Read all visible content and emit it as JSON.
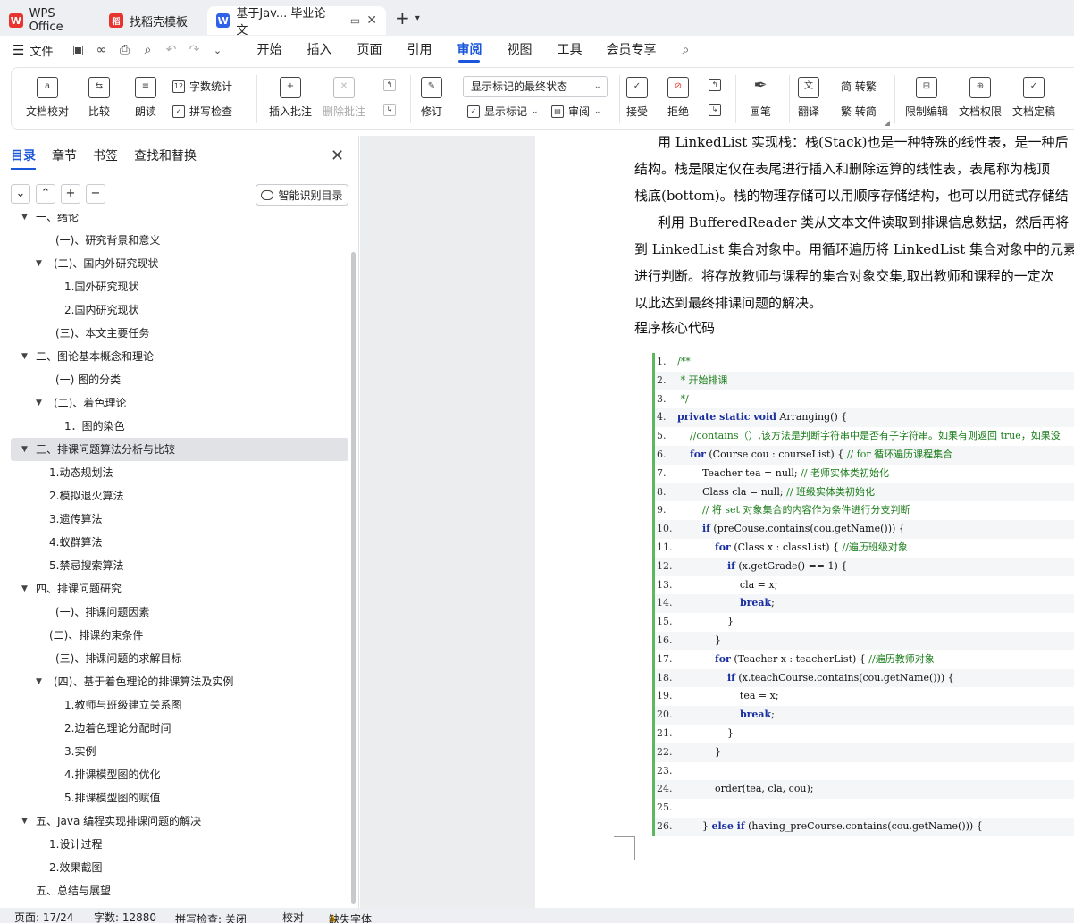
{
  "tabs": [
    {
      "label": "WPS Office",
      "logo": "W"
    },
    {
      "label": "找稻壳模板",
      "logo": "稻"
    },
    {
      "label": "基于Jav... 毕业论文",
      "logo": "W"
    }
  ],
  "menubar": {
    "file": "文件",
    "items": [
      "开始",
      "插入",
      "页面",
      "引用",
      "审阅",
      "视图",
      "工具",
      "会员专享"
    ],
    "active": "审阅"
  },
  "ribbon": {
    "doc_check": "文档校对",
    "compare": "比较",
    "read_aloud": "朗读",
    "word_count": "字数统计",
    "spell_check": "拼写检查",
    "insert_comment": "插入批注",
    "delete_comment": "删除批注",
    "revise": "修订",
    "markup_select": "显示标记的最终状态",
    "show_markup": "显示标记",
    "review_pane": "审阅",
    "accept": "接受",
    "reject": "拒绝",
    "pen": "画笔",
    "translate": "翻译",
    "to_traditional": "简 转繁",
    "to_simplified": "繁 转简",
    "restrict_edit": "限制编辑",
    "doc_permission": "文档权限",
    "doc_finalize": "文档定稿"
  },
  "nav": {
    "tabs": [
      "目录",
      "章节",
      "书签",
      "查找和替换"
    ],
    "active_tab": "目录",
    "smart_btn": "智能识别目录",
    "toc": [
      {
        "label": "一、绪论",
        "level": 0,
        "arrow": true
      },
      {
        "label": "(一)、研究背景和意义",
        "level": 2,
        "arrow": false
      },
      {
        "label": "(二)、国内外研究现状",
        "level": 1,
        "arrow": true
      },
      {
        "label": "1.国外研究现状",
        "level": 3,
        "arrow": false
      },
      {
        "label": "2.国内研究现状",
        "level": 3,
        "arrow": false
      },
      {
        "label": "(三)、本文主要任务",
        "level": 2,
        "arrow": false
      },
      {
        "label": "二、图论基本概念和理论",
        "level": 0,
        "arrow": true
      },
      {
        "label": "(一) 图的分类",
        "level": 2,
        "arrow": false
      },
      {
        "label": "(二)、着色理论",
        "level": 1,
        "arrow": true
      },
      {
        "label": "1．图的染色",
        "level": 3,
        "arrow": false
      },
      {
        "label": "三、排课问题算法分析与比较",
        "level": 0,
        "arrow": true,
        "selected": true
      },
      {
        "label": "1.动态规划法",
        "level": 4,
        "arrow": false
      },
      {
        "label": "2.模拟退火算法",
        "level": 4,
        "arrow": false
      },
      {
        "label": "3.遗传算法",
        "level": 4,
        "arrow": false
      },
      {
        "label": "4.蚁群算法",
        "level": 4,
        "arrow": false
      },
      {
        "label": "5.禁忌搜索算法",
        "level": 4,
        "arrow": false
      },
      {
        "label": "四、排课问题研究",
        "level": 0,
        "arrow": true
      },
      {
        "label": "(一)、排课问题因素",
        "level": 2,
        "arrow": false
      },
      {
        "label": "(二)、排课约束条件",
        "level": 4,
        "arrow": false
      },
      {
        "label": "(三)、排课问题的求解目标",
        "level": 2,
        "arrow": false
      },
      {
        "label": "(四)、基于着色理论的排课算法及实例",
        "level": 1,
        "arrow": true
      },
      {
        "label": "1.教师与班级建立关系图",
        "level": 3,
        "arrow": false
      },
      {
        "label": "2.边着色理论分配时间",
        "level": 3,
        "arrow": false
      },
      {
        "label": "3.实例",
        "level": 3,
        "arrow": false
      },
      {
        "label": "4.排课模型图的优化",
        "level": 3,
        "arrow": false
      },
      {
        "label": "5.排课模型图的赋值",
        "level": 3,
        "arrow": false
      },
      {
        "label": "五、Java 编程实现排课问题的解决",
        "level": 0,
        "arrow": true
      },
      {
        "label": "1.设计过程",
        "level": 4,
        "arrow": false
      },
      {
        "label": "2.效果截图",
        "level": 4,
        "arrow": false
      },
      {
        "label": "五、总结与展望",
        "level": 0,
        "arrow": false
      }
    ]
  },
  "doc": {
    "paragraphs": [
      "用 LinkedList 实现栈：栈(Stack)也是一种特殊的线性表，是一种后",
      "结构。栈是限定仅在表尾进行插入和删除运算的线性表，表尾称为栈顶",
      "栈底(bottom)。栈的物理存储可以用顺序存储结构，也可以用链式存储结",
      "利用 BufferedReader 类从文本文件读取到排课信息数据，然后再将",
      "到 LinkedList 集合对象中。用循环遍历将 LinkedList 集合对象中的元素",
      "进行判断。将存放教师与课程的集合对象交集,取出教师和课程的一定次",
      "以此达到最终排课问题的解决。",
      "程序核心代码"
    ],
    "code_lines": [
      {
        "n": "1.",
        "parts": [
          {
            "t": "/**",
            "c": "cm"
          }
        ]
      },
      {
        "n": "2.",
        "parts": [
          {
            "t": " * 开始排课",
            "c": "cm"
          }
        ]
      },
      {
        "n": "3.",
        "parts": [
          {
            "t": " */",
            "c": "cm"
          }
        ]
      },
      {
        "n": "4.",
        "parts": [
          {
            "t": "private static void",
            "c": "kw"
          },
          {
            "t": " Arranging() {",
            "c": ""
          }
        ]
      },
      {
        "n": "5.",
        "parts": [
          {
            "t": "    //contains（）,该方法是判断字符串中是否有子字符串。如果有则返回 true，如果没",
            "c": "cm"
          }
        ]
      },
      {
        "n": "6.",
        "parts": [
          {
            "t": "    ",
            "c": ""
          },
          {
            "t": "for",
            "c": "kw"
          },
          {
            "t": " (Course cou : courseList) { ",
            "c": ""
          },
          {
            "t": "// for 循环遍历课程集合",
            "c": "cm"
          }
        ]
      },
      {
        "n": "7.",
        "parts": [
          {
            "t": "        Teacher tea = null; ",
            "c": ""
          },
          {
            "t": "// 老师实体类初始化",
            "c": "cm"
          }
        ]
      },
      {
        "n": "8.",
        "parts": [
          {
            "t": "        Class cla = null; ",
            "c": ""
          },
          {
            "t": "// 班级实体类初始化",
            "c": "cm"
          }
        ]
      },
      {
        "n": "9.",
        "parts": [
          {
            "t": "        // 将 set 对象集合的内容作为条件进行分支判断",
            "c": "cm"
          }
        ]
      },
      {
        "n": "10.",
        "parts": [
          {
            "t": "        ",
            "c": ""
          },
          {
            "t": "if",
            "c": "kw"
          },
          {
            "t": " (preCouse.contains(cou.getName())) {",
            "c": ""
          }
        ]
      },
      {
        "n": "11.",
        "parts": [
          {
            "t": "            ",
            "c": ""
          },
          {
            "t": "for",
            "c": "kw"
          },
          {
            "t": " (Class x : classList) { ",
            "c": ""
          },
          {
            "t": "//遍历班级对象",
            "c": "cm"
          }
        ]
      },
      {
        "n": "12.",
        "parts": [
          {
            "t": "                ",
            "c": ""
          },
          {
            "t": "if",
            "c": "kw"
          },
          {
            "t": " (x.getGrade() == 1) {",
            "c": ""
          }
        ]
      },
      {
        "n": "13.",
        "parts": [
          {
            "t": "                    cla = x;",
            "c": ""
          }
        ]
      },
      {
        "n": "14.",
        "parts": [
          {
            "t": "                    ",
            "c": ""
          },
          {
            "t": "break",
            "c": "kw"
          },
          {
            "t": ";",
            "c": ""
          }
        ]
      },
      {
        "n": "15.",
        "parts": [
          {
            "t": "                }",
            "c": ""
          }
        ]
      },
      {
        "n": "16.",
        "parts": [
          {
            "t": "            }",
            "c": ""
          }
        ]
      },
      {
        "n": "17.",
        "parts": [
          {
            "t": "            ",
            "c": ""
          },
          {
            "t": "for",
            "c": "kw"
          },
          {
            "t": " (Teacher x : teacherList) { ",
            "c": ""
          },
          {
            "t": "//遍历教师对象",
            "c": "cm"
          }
        ]
      },
      {
        "n": "18.",
        "parts": [
          {
            "t": "                ",
            "c": ""
          },
          {
            "t": "if",
            "c": "kw"
          },
          {
            "t": " (x.teachCourse.contains(cou.getName())) {",
            "c": ""
          }
        ]
      },
      {
        "n": "19.",
        "parts": [
          {
            "t": "                    tea = x;",
            "c": ""
          }
        ]
      },
      {
        "n": "20.",
        "parts": [
          {
            "t": "                    ",
            "c": ""
          },
          {
            "t": "break",
            "c": "kw"
          },
          {
            "t": ";",
            "c": ""
          }
        ]
      },
      {
        "n": "21.",
        "parts": [
          {
            "t": "                }",
            "c": ""
          }
        ]
      },
      {
        "n": "22.",
        "parts": [
          {
            "t": "            }",
            "c": ""
          }
        ]
      },
      {
        "n": "23.",
        "parts": [
          {
            "t": "",
            "c": ""
          }
        ]
      },
      {
        "n": "24.",
        "parts": [
          {
            "t": "            order(tea, cla, cou);",
            "c": ""
          }
        ]
      },
      {
        "n": "25.",
        "parts": [
          {
            "t": "",
            "c": ""
          }
        ]
      },
      {
        "n": "26.",
        "parts": [
          {
            "t": "        } ",
            "c": ""
          },
          {
            "t": "else if",
            "c": "kw"
          },
          {
            "t": " (having_preCourse.contains(cou.getName())) {",
            "c": ""
          }
        ]
      }
    ]
  },
  "status": {
    "page": "页面: 17/24",
    "words": "字数: 12880",
    "spell": "拼写检查: 关闭",
    "proof": "校对",
    "missing_font": "缺失字体"
  },
  "colors": {
    "accent": "#1a56db",
    "code_bar": "#5cb85c",
    "comment": "#1b7d1b",
    "keyword": "#1a2fa0"
  }
}
